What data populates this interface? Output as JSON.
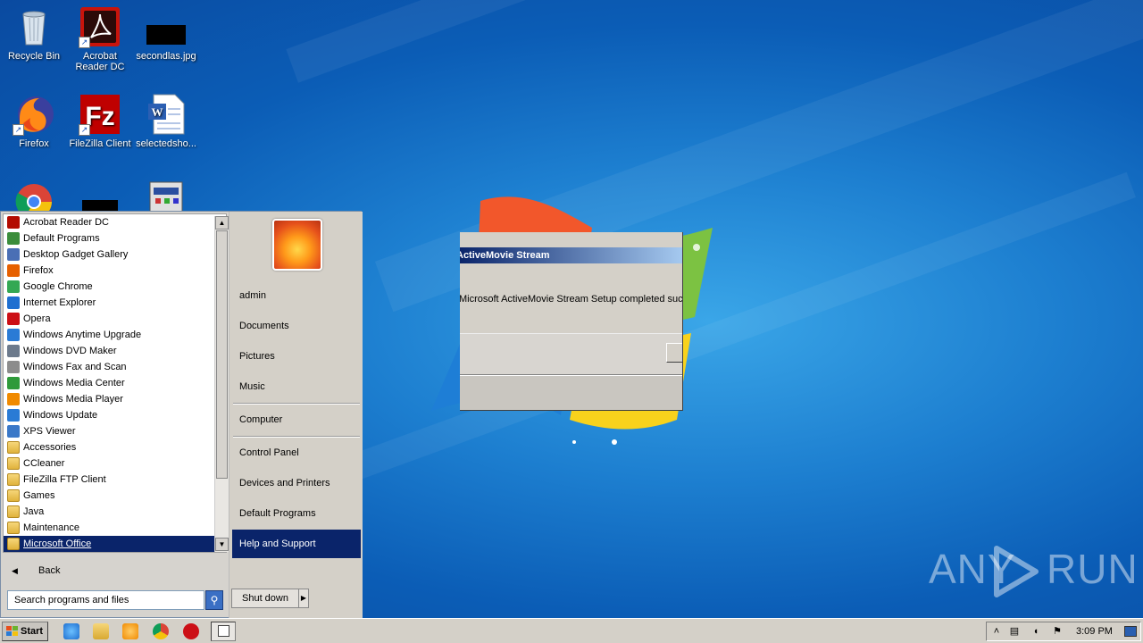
{
  "desktop": {
    "icons": [
      {
        "label": "Recycle Bin",
        "icon": "recycle-bin-icon"
      },
      {
        "label": "Acrobat Reader DC",
        "label_line1": "Acrobat",
        "label_line2": "Reader DC",
        "icon": "acrobat-icon"
      },
      {
        "label": "secondlas.jpg",
        "icon": "image-file-icon"
      },
      {
        "label": "Firefox",
        "icon": "firefox-icon"
      },
      {
        "label": "FileZilla Client",
        "icon": "filezilla-icon"
      },
      {
        "label": "selectedsho...",
        "icon": "word-document-icon"
      }
    ],
    "watermark": "ANY RUN",
    "watermark_left": "ANY",
    "watermark_right": "RUN"
  },
  "start_menu": {
    "programs": [
      {
        "label": "Acrobat Reader DC",
        "icon": "acrobat-icon",
        "color": "#b30b00"
      },
      {
        "label": "Default Programs",
        "icon": "default-programs-icon",
        "color": "#3b8d3b"
      },
      {
        "label": "Desktop Gadget Gallery",
        "icon": "gadget-icon",
        "color": "#4a6fb5"
      },
      {
        "label": "Firefox",
        "icon": "firefox-icon",
        "color": "#e66000"
      },
      {
        "label": "Google Chrome",
        "icon": "chrome-icon",
        "color": "#34a853"
      },
      {
        "label": "Internet Explorer",
        "icon": "ie-icon",
        "color": "#1e6fd0"
      },
      {
        "label": "Opera",
        "icon": "opera-icon",
        "color": "#cc0f16"
      },
      {
        "label": "Windows Anytime Upgrade",
        "icon": "windows-icon",
        "color": "#2a7bd5"
      },
      {
        "label": "Windows DVD Maker",
        "icon": "dvd-icon",
        "color": "#6c7a8c"
      },
      {
        "label": "Windows Fax and Scan",
        "icon": "fax-icon",
        "color": "#8c8c8c"
      },
      {
        "label": "Windows Media Center",
        "icon": "media-center-icon",
        "color": "#2f9a3a"
      },
      {
        "label": "Windows Media Player",
        "icon": "media-player-icon",
        "color": "#f08a00"
      },
      {
        "label": "Windows Update",
        "icon": "windows-update-icon",
        "color": "#2a7bd5"
      },
      {
        "label": "XPS Viewer",
        "icon": "xps-icon",
        "color": "#3a78c8"
      },
      {
        "label": "Accessories",
        "icon": "folder-icon",
        "folder": true
      },
      {
        "label": "CCleaner",
        "icon": "folder-icon",
        "folder": true
      },
      {
        "label": "FileZilla FTP Client",
        "icon": "folder-icon",
        "folder": true
      },
      {
        "label": "Games",
        "icon": "folder-icon",
        "folder": true
      },
      {
        "label": "Java",
        "icon": "folder-icon",
        "folder": true
      },
      {
        "label": "Maintenance",
        "icon": "folder-icon",
        "folder": true
      },
      {
        "label": "Microsoft Office",
        "icon": "folder-icon",
        "folder": true,
        "selected": true
      }
    ],
    "back_label": "Back",
    "search_placeholder": "Search programs and files",
    "right_items": [
      {
        "label": "admin"
      },
      {
        "label": "Documents"
      },
      {
        "label": "Pictures"
      },
      {
        "label": "Music"
      },
      {
        "label": "Computer"
      },
      {
        "label": "Control Panel"
      },
      {
        "label": "Devices and Printers"
      },
      {
        "label": "Default Programs"
      },
      {
        "label": "Help and Support",
        "selected": true
      }
    ],
    "shutdown_label": "Shut down"
  },
  "dialog": {
    "title": "ActiveMovie Stream",
    "message": "Microsoft ActiveMovie Stream Setup completed successfully."
  },
  "taskbar": {
    "start_label": "Start",
    "clock": "3:09 PM",
    "pinned": [
      "ie-icon",
      "explorer-icon",
      "media-player-icon",
      "chrome-icon",
      "opera-icon",
      "active-window-icon"
    ]
  }
}
